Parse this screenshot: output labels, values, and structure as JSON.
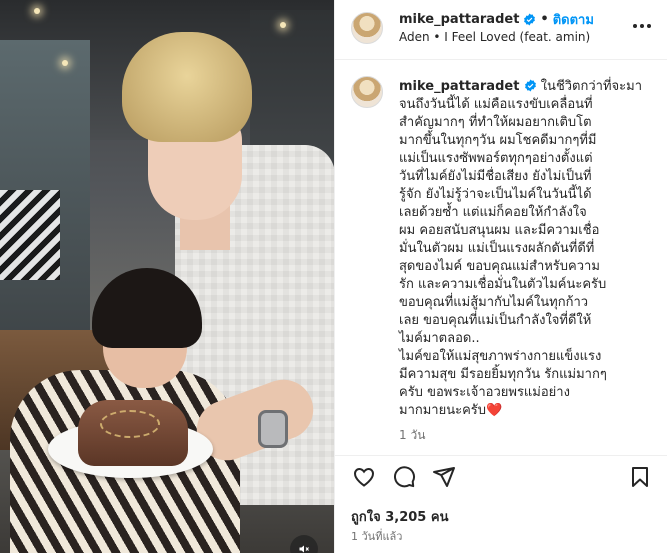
{
  "post": {
    "username": "mike_pattaradet",
    "follow_label": "ติดตาม",
    "separator": "•",
    "song": "Aden • I Feel Loved (feat. amin)",
    "caption_lines": [
      "ในชีวิตกว่าที่จะมา",
      "จนถึงวันนี้ได้ แม่คือแรงขับเคลื่อนที่",
      "สำคัญมากๆ ที่ทำให้ผมอยากเติบโต",
      "มากขึ้นในทุกๆวัน ผมโชคดีมากๆที่มี",
      "แม่เป็นแรงซัพพอร์ตทุกๆอย่างตั้งแต่",
      "วันที่ไมค์ยังไม่มีชื่อเสียง ยังไม่เป็นที่",
      "รู้จัก ยังไม่รู้ว่าจะเป็นไมค์ในวันนี้ได้",
      "เลยด้วยซ้ำ แต่แม่ก็คอยให้กำลังใจ",
      "ผม คอยสนับสนุนผม และมีความเชื่อ",
      "มั่นในตัวผม แม่เป็นแรงผลักดันที่ดีที่",
      "สุดของไมค์ ขอบคุณแม่สำหรับความ",
      "รัก และความเชื่อมั่นในตัวไมค์นะครับ",
      "ขอบคุณที่แม่สู้มากับไมค์ในทุกก้าว",
      "เลย ขอบคุณที่แม่เป็นกำลังใจที่ดีให้",
      "ไมค์มาตลอด..",
      "ไมค์ขอให้แม่สุขภาพร่างกายแข็งแรง",
      "มีความสุข มีรอยยิ้มทุกวัน รักแม่มากๆ",
      "ครับ ขอพระเจ้าอวยพรแม่อย่าง",
      "มากมายนะครับ"
    ],
    "caption_emoji": "❤️",
    "caption_time": "1 วัน",
    "likes_text": "ถูกใจ 3,205 คน",
    "posted_time": "1 วันที่แล้ว"
  },
  "icons": {
    "verified": "verified-badge-icon",
    "more": "more-options-icon",
    "like": "heart-icon",
    "comment": "comment-icon",
    "share": "send-icon",
    "save": "bookmark-icon",
    "sound": "speaker-muted-icon"
  },
  "colors": {
    "accent": "#0095f6",
    "verified": "#0095f6",
    "text": "#262626",
    "muted": "#737373",
    "heart_emoji": "#e0245e"
  }
}
